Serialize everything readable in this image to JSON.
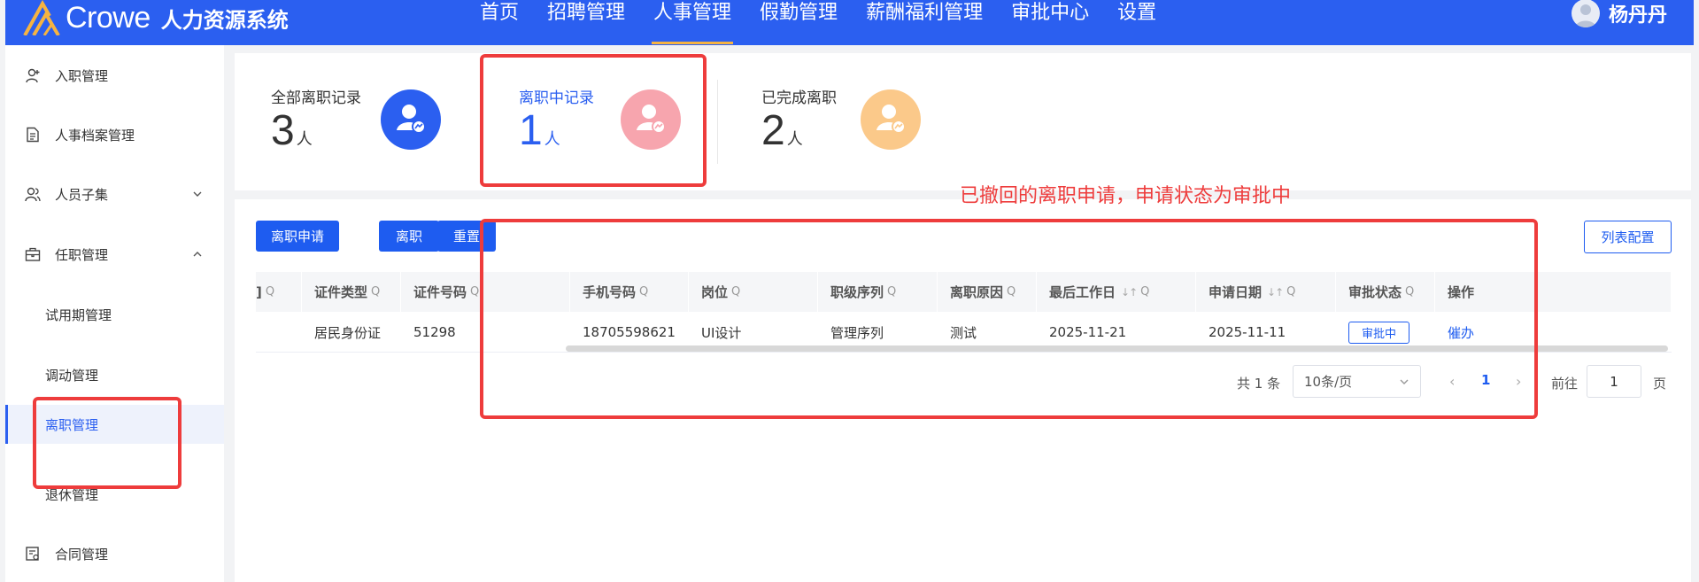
{
  "header": {
    "brand": "Crowe",
    "system_name": "人力资源系统",
    "nav": [
      "首页",
      "招聘管理",
      "人事管理",
      "假勤管理",
      "薪酬福利管理",
      "审批中心",
      "设置"
    ],
    "active_nav": "人事管理",
    "user_name": "杨丹丹",
    "colors": {
      "primary": "#2b5ff0",
      "nav_indicator": "#f5b342"
    }
  },
  "sidebar": {
    "items": [
      {
        "label": "入职管理",
        "icon": "user-add-icon"
      },
      {
        "label": "人事档案管理",
        "icon": "document-icon"
      },
      {
        "label": "人员子集",
        "icon": "users-icon",
        "chevron": "down"
      },
      {
        "label": "任职管理",
        "icon": "briefcase-icon",
        "chevron": "up"
      }
    ],
    "sub_items": [
      "试用期管理",
      "调动管理",
      "离职管理",
      "退休管理"
    ],
    "active_sub": "离职管理",
    "bottom_item": {
      "label": "合同管理",
      "icon": "contract-icon"
    }
  },
  "stats": [
    {
      "label": "全部离职记录",
      "value": "3",
      "unit": "人",
      "color": "#2b5ff0"
    },
    {
      "label": "离职中记录",
      "value": "1",
      "unit": "人",
      "color": "#f7a5ae"
    },
    {
      "label": "已完成离职",
      "value": "2",
      "unit": "人",
      "color": "#fbc98a"
    }
  ],
  "annotation": {
    "text": "已撤回的离职申请，申请状态为审批中",
    "color": "#ee3c3c"
  },
  "toolbar": {
    "apply_label": "离职申请",
    "resign_label": "离职",
    "reset_label": "重置",
    "config_label": "列表配置"
  },
  "table": {
    "columns": [
      "证件类型",
      "证件号码",
      "手机号码",
      "岗位",
      "职级序列",
      "离职原因",
      "最后工作日",
      "申请日期",
      "审批状态",
      "操作"
    ],
    "clipped_column_tail": "]",
    "rows": [
      {
        "id_type": "居民身份证",
        "id_number": "51298",
        "phone": "18705598621",
        "position": "UI设计",
        "rank_series": "管理序列",
        "reason": "测试",
        "last_day": "2025-11-21",
        "apply_date": "2025-11-11",
        "status": "审批中",
        "action": "催办"
      }
    ]
  },
  "pagination": {
    "total": "共 1 条",
    "page_size": "10条/页",
    "current_page": "1",
    "goto_label": "前往",
    "goto_value": "1",
    "page_suffix": "页"
  }
}
